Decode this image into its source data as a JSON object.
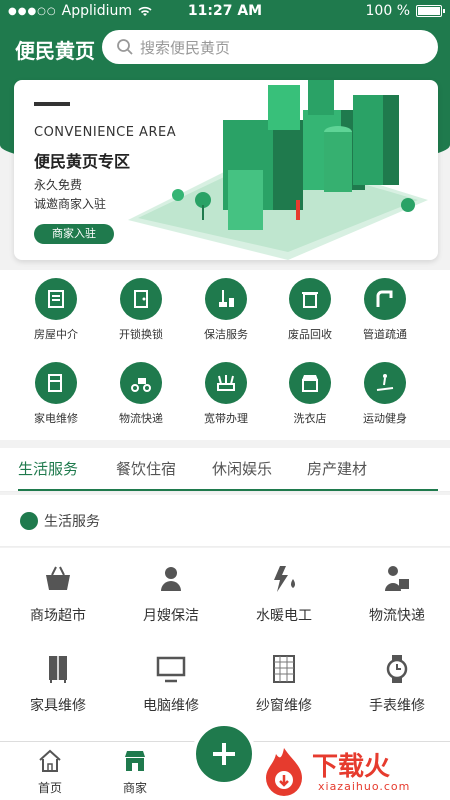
{
  "statusbar": {
    "carrier": "Applidium",
    "time": "11:27 AM",
    "battery": "100 %"
  },
  "header": {
    "title": "便民黄页",
    "search_placeholder": "搜索便民黄页"
  },
  "banner": {
    "en_title": "CONVENIENCE AREA",
    "zh_title": "便民黄页专区",
    "line1": "永久免费",
    "line2": "诚邀商家入驻",
    "button": "商家入驻"
  },
  "categories": [
    {
      "label": "房屋中介",
      "icon": "house-agent-icon"
    },
    {
      "label": "开锁换锁",
      "icon": "door-lock-icon"
    },
    {
      "label": "保洁服务",
      "icon": "cleaning-icon"
    },
    {
      "label": "废品回收",
      "icon": "recycle-bin-icon"
    },
    {
      "label": "管道疏通",
      "icon": "pipe-icon"
    },
    {
      "label": "家电维修",
      "icon": "appliance-repair-icon"
    },
    {
      "label": "物流快递",
      "icon": "delivery-scooter-icon"
    },
    {
      "label": "宽带办理",
      "icon": "router-icon"
    },
    {
      "label": "洗衣店",
      "icon": "laundry-shop-icon"
    },
    {
      "label": "运动健身",
      "icon": "treadmill-icon"
    }
  ],
  "tabs": [
    {
      "label": "生活服务",
      "active": true
    },
    {
      "label": "餐饮住宿",
      "active": false
    },
    {
      "label": "休闲娱乐",
      "active": false
    },
    {
      "label": "房产建材",
      "active": false
    }
  ],
  "section_title": "生活服务",
  "services": [
    {
      "label": "商场超市",
      "icon": "basket-icon"
    },
    {
      "label": "月嫂保洁",
      "icon": "nanny-icon"
    },
    {
      "label": "水暖电工",
      "icon": "water-electric-icon"
    },
    {
      "label": "物流快递",
      "icon": "courier-icon"
    },
    {
      "label": "家具维修",
      "icon": "cabinet-icon"
    },
    {
      "label": "电脑维修",
      "icon": "monitor-icon"
    },
    {
      "label": "纱窗维修",
      "icon": "window-screen-icon"
    },
    {
      "label": "手表维修",
      "icon": "watch-icon"
    }
  ],
  "tabbar": {
    "home": "首页",
    "merchant": "商家"
  },
  "watermark": {
    "text": "下载火",
    "sub": "xiazaihuo.com"
  },
  "colors": {
    "primary": "#1f7a4d",
    "watermark": "#e63b2e"
  }
}
